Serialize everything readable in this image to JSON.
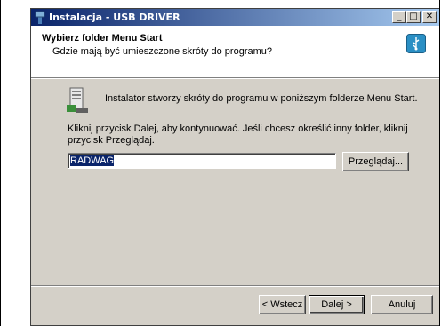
{
  "window": {
    "title": "Instalacja - USB DRIVER",
    "minimize_glyph": "_",
    "maximize_glyph": "□",
    "close_glyph": "✕"
  },
  "header": {
    "title": "Wybierz folder Menu Start",
    "subtitle": "Gdzie mają być umieszczone skróty do programu?"
  },
  "body": {
    "info_text": "Instalator stworzy skróty do programu w poniższym folderze Menu Start.",
    "instruction_text": "Kliknij przycisk Dalej, aby kontynuować. Jeśli chcesz określić inny folder, kliknij przycisk Przeglądaj.",
    "folder_value": "RADWAG",
    "browse_label": "Przeglądaj..."
  },
  "footer": {
    "back_label": "< Wstecz",
    "next_label": "Dalej >",
    "cancel_label": "Anuluj"
  },
  "colors": {
    "titlebar_start": "#0a246a",
    "titlebar_end": "#a6caf0",
    "dialog_bg": "#d4d0c8"
  }
}
